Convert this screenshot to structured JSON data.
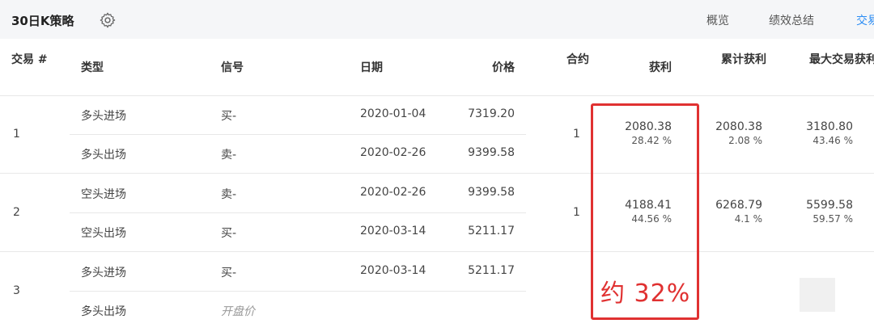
{
  "header": {
    "title": "30日K策略",
    "tabs": [
      {
        "label": "概览",
        "active": false
      },
      {
        "label": "绩效总结",
        "active": false
      },
      {
        "label": "交易",
        "active": true
      }
    ]
  },
  "table": {
    "headers": {
      "trade_no": "交易 #",
      "type": "类型",
      "signal": "信号",
      "date": "日期",
      "price": "价格",
      "contracts": "合约",
      "profit": "获利",
      "cum_profit": "累计获利",
      "max_profit": "最大交易获利"
    },
    "trades": [
      {
        "no": "1",
        "contracts": "1",
        "profit": "2080.38",
        "profit_pct": "28.42 %",
        "cum_profit": "2080.38",
        "cum_profit_pct": "2.08 %",
        "max_profit": "3180.80",
        "max_profit_pct": "43.46 %",
        "entry": {
          "type": "多头进场",
          "signal": "买-",
          "date": "2020-01-04",
          "price": "7319.20"
        },
        "exit": {
          "type": "多头出场",
          "signal": "卖-",
          "date": "2020-02-26",
          "price": "9399.58"
        }
      },
      {
        "no": "2",
        "contracts": "1",
        "profit": "4188.41",
        "profit_pct": "44.56 %",
        "cum_profit": "6268.79",
        "cum_profit_pct": "4.1 %",
        "max_profit": "5599.58",
        "max_profit_pct": "59.57 %",
        "entry": {
          "type": "空头进场",
          "signal": "卖-",
          "date": "2020-02-26",
          "price": "9399.58"
        },
        "exit": {
          "type": "空头出场",
          "signal": "买-",
          "date": "2020-03-14",
          "price": "5211.17"
        }
      },
      {
        "no": "3",
        "entry": {
          "type": "多头进场",
          "signal": "买-",
          "date": "2020-03-14",
          "price": "5211.17"
        },
        "exit": {
          "type": "多头出场",
          "signal": "开盘价"
        }
      }
    ]
  },
  "annotation": {
    "text": "约 32%",
    "color": "#e03131"
  },
  "colors": {
    "accent": "#2c8df4",
    "header_bg": "#f5f6f8"
  }
}
